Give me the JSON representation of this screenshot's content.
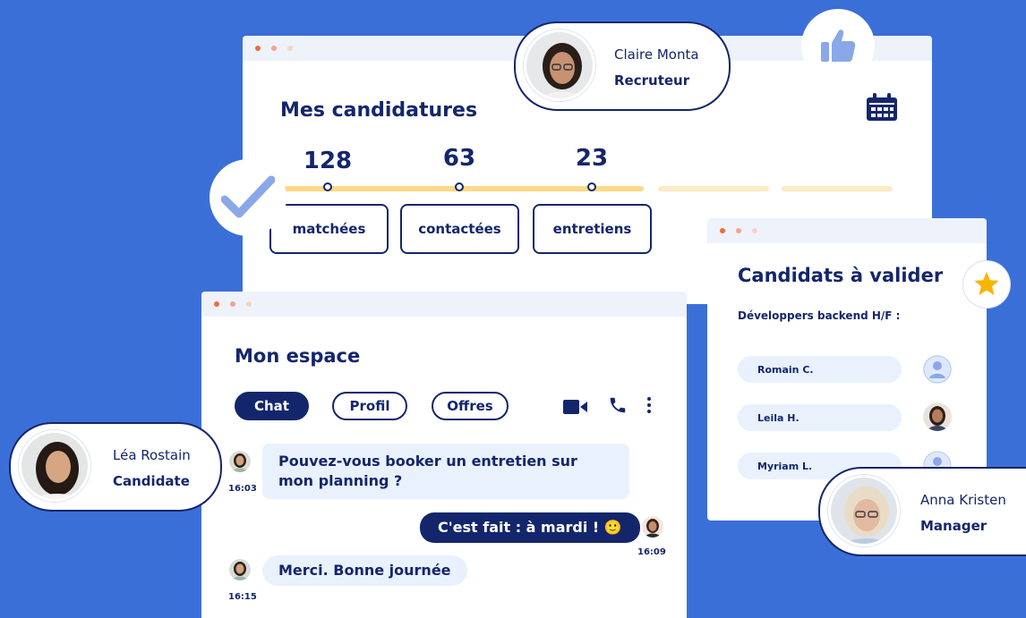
{
  "applications": {
    "title": "Mes candidatures",
    "stats": [
      {
        "value": "128",
        "label": "matchées"
      },
      {
        "value": "63",
        "label": "contactées"
      },
      {
        "value": "23",
        "label": "entretiens"
      }
    ]
  },
  "workspace": {
    "title": "Mon espace",
    "tabs": [
      "Chat",
      "Profil",
      "Offres"
    ],
    "active_tab": "Chat",
    "messages": [
      {
        "text": "Pouvez-vous booker un entretien sur mon planning ?",
        "time": "16:03",
        "from": "candidate"
      },
      {
        "text": "C'est fait : à mardi ! 🙂",
        "time": "16:09",
        "from": "me"
      },
      {
        "text": "Merci. Bonne journée",
        "time": "16:15",
        "from": "candidate"
      }
    ]
  },
  "validation": {
    "title": "Candidats à valider",
    "subtitle": "Développers backend H/F :",
    "candidates": [
      "Romain C.",
      "Leila H.",
      "Myriam L."
    ]
  },
  "profiles": {
    "recruiter": {
      "name": "Claire Monta",
      "role": "Recruteur"
    },
    "candidate": {
      "name": "Léa Rostain",
      "role": "Candidate"
    },
    "manager": {
      "name": "Anna Kristen",
      "role": "Manager"
    }
  },
  "icons": [
    "thumbs-up-icon",
    "calendar-icon",
    "check-icon",
    "star-icon",
    "video-icon",
    "phone-icon",
    "more-vertical-icon",
    "user-placeholder-icon"
  ],
  "colors": {
    "background": "#3b6fd8",
    "navy": "#14266b",
    "progress": "#ffd889",
    "bubble": "#e9f1fd",
    "star": "#f7b500"
  }
}
